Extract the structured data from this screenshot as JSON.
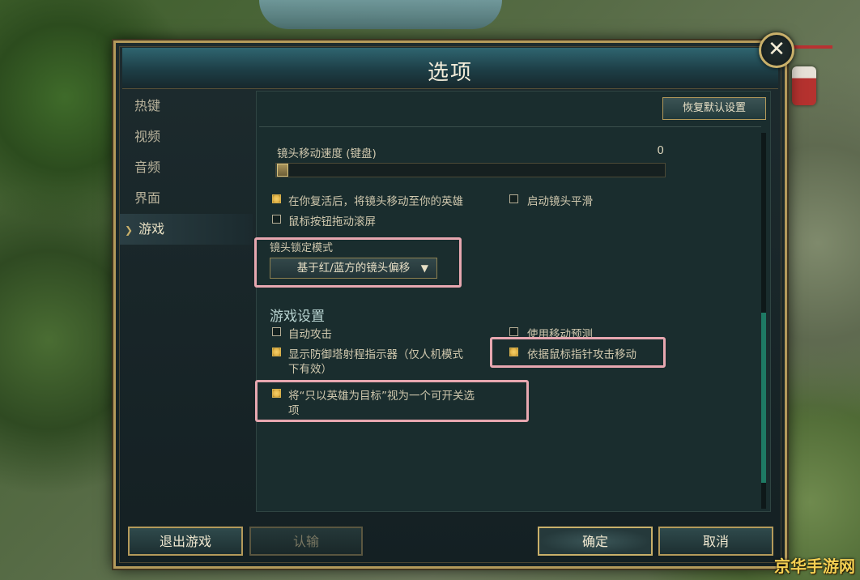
{
  "window": {
    "title": "选项",
    "close_label": "✕"
  },
  "sidebar": {
    "items": [
      {
        "label": "热键"
      },
      {
        "label": "视频"
      },
      {
        "label": "音频"
      },
      {
        "label": "界面"
      },
      {
        "label": "游戏",
        "active": true
      }
    ]
  },
  "content": {
    "restore_defaults_label": "恢复默认设置",
    "camera_speed": {
      "label": "镜头移动速度 (键盘)",
      "value": "0",
      "fraction": 0.0
    },
    "options": {
      "move_camera_to_champion": {
        "label": "在你复活后，将镜头移动至你的英雄",
        "checked": true
      },
      "camera_smoothing": {
        "label": "启动镜头平滑",
        "checked": false
      },
      "mouse_drag_scroll": {
        "label": "鼠标按钮拖动滚屏",
        "checked": false
      }
    },
    "camera_lock": {
      "label": "镜头锁定模式",
      "selected": "基于红/蓝方的镜头偏移"
    },
    "game_settings": {
      "title": "游戏设置",
      "auto_attack": {
        "label": "自动攻击",
        "checked": false
      },
      "move_prediction": {
        "label": "使用移动预测",
        "checked": false
      },
      "tower_range": {
        "label_line1": "显示防御塔射程指示器（仅人机模式",
        "label_line2": "下有效）",
        "checked": true
      },
      "attack_move_cursor": {
        "label": "依据鼠标指针攻击移动",
        "checked": true
      },
      "target_champions_only": {
        "label_line1": "将“只以英雄为目标”视为一个可开关选",
        "label_line2": "项",
        "checked": true
      }
    }
  },
  "footer": {
    "exit_label": "退出游戏",
    "surrender_label": "认输",
    "ok_label": "确定",
    "cancel_label": "取消"
  },
  "watermark": "京华手游网",
  "colors": {
    "gold": "#b49a5b",
    "highlight": "#e7a7b0",
    "checkbox_checked": "#e5b64a",
    "scroll_thumb": "#1e7a64"
  }
}
